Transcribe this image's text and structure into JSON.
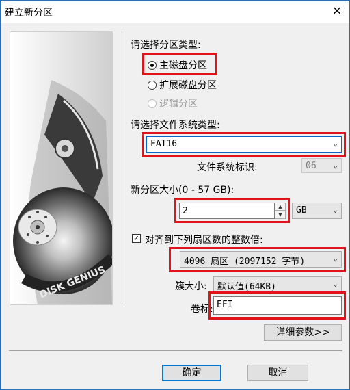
{
  "window": {
    "title": "建立新分区",
    "close_icon": "×"
  },
  "art": {
    "brand": "DISK GENIUS"
  },
  "partition_type": {
    "label": "请选择分区类型:",
    "options": [
      {
        "label": "主磁盘分区",
        "selected": true,
        "enabled": true
      },
      {
        "label": "扩展磁盘分区",
        "selected": false,
        "enabled": true
      },
      {
        "label": "逻辑分区",
        "selected": false,
        "enabled": false
      }
    ]
  },
  "filesystem": {
    "label": "请选择文件系统类型:",
    "value": "FAT16",
    "id_label": "文件系统标识:",
    "id_value": "06"
  },
  "size": {
    "label": "新分区大小(0 - 57 GB):",
    "value": "2",
    "unit": "GB"
  },
  "align": {
    "label": "对齐到下列扇区数的整数倍:",
    "checked": true,
    "value": "4096 扇区 (2097152 字节)"
  },
  "cluster": {
    "label": "簇大小:",
    "value": "默认值(64KB)"
  },
  "volume": {
    "label": "卷标:",
    "value": "EFI"
  },
  "buttons": {
    "details": "详细参数>>",
    "ok": "确定",
    "cancel": "取消"
  },
  "colors": {
    "highlight": "#e3131b",
    "focus": "#0078d7"
  }
}
